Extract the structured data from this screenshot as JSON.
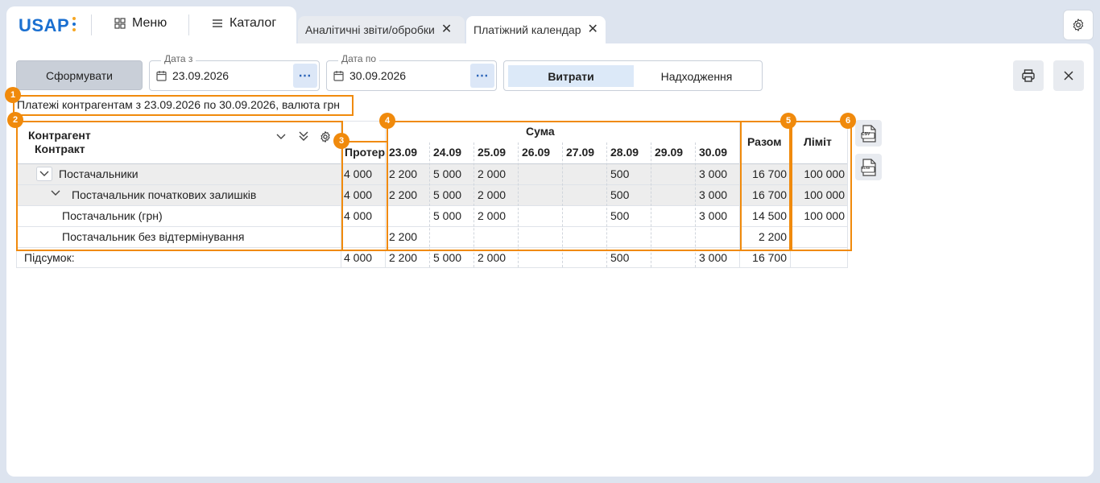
{
  "app": {
    "logo_text": "USAP",
    "logo_dot_colors": [
      "#f5a623",
      "#1a6fd0",
      "#f5a623"
    ],
    "menu_label": "Меню",
    "catalog_label": "Каталог"
  },
  "tabs": [
    {
      "label": "Аналітичні звіти/обробки",
      "active": false
    },
    {
      "label": "Платіжний календар",
      "active": true
    }
  ],
  "toolbar": {
    "generate_label": "Сформувати",
    "date_from_label": "Дата з",
    "date_from_value": "23.09.2026",
    "date_to_label": "Дата по",
    "date_to_value": "30.09.2026",
    "dots_label": "⋯",
    "toggle": [
      "Витрати",
      "Надходження"
    ],
    "toggle_active": "Витрати"
  },
  "report_title": "Платежі контрагентам з 23.09.2026 по 30.09.2026, валюта грн",
  "table": {
    "header_col1_line1": "Контрагент",
    "header_col1_line2": "Контракт",
    "header_overdue": "Протер",
    "header_sum": "Сума",
    "header_total": "Разом",
    "header_limit": "Ліміт",
    "dates": [
      "23.09",
      "24.09",
      "25.09",
      "26.09",
      "27.09",
      "28.09",
      "29.09",
      "30.09"
    ],
    "rows": [
      {
        "name": "Постачальники",
        "overdue": "4 000",
        "days": [
          "2 200",
          "5 000",
          "2 000",
          "",
          "",
          "500",
          "",
          "3 000"
        ],
        "total": "16 700",
        "limit": "100 000"
      },
      {
        "name": "Постачальник початкових залишків",
        "overdue": "4 000",
        "days": [
          "2 200",
          "5 000",
          "2 000",
          "",
          "",
          "500",
          "",
          "3 000"
        ],
        "total": "16 700",
        "limit": "100 000"
      },
      {
        "name": "Постачальник (грн)",
        "overdue": "4 000",
        "days": [
          "",
          "5 000",
          "2 000",
          "",
          "",
          "500",
          "",
          "3 000"
        ],
        "total": "14 500",
        "limit": "100 000"
      },
      {
        "name": "Постачальник без відтермінування",
        "overdue": "",
        "days": [
          "2 200",
          "",
          "",
          "",
          "",
          "",
          "",
          ""
        ],
        "total": "2 200",
        "limit": ""
      }
    ],
    "summary": {
      "name": "Підсумок:",
      "overdue": "4 000",
      "days": [
        "2 200",
        "5 000",
        "2 000",
        "",
        "",
        "500",
        "",
        "3 000"
      ],
      "total": "16 700",
      "limit": ""
    }
  },
  "exports": [
    "CSV",
    "XLSX"
  ],
  "annotations": [
    "1",
    "2",
    "3",
    "4",
    "5",
    "6"
  ],
  "accent_color": "#f08a0c"
}
